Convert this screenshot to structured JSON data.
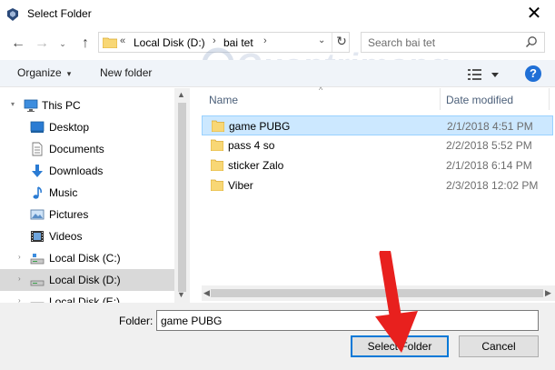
{
  "window": {
    "title": "Select Folder",
    "close_glyph": "✕"
  },
  "nav": {
    "back_glyph": "←",
    "forward_glyph": "→",
    "recent_glyph": "⌄",
    "up_glyph": "↑"
  },
  "address": {
    "overflow": "«",
    "segments": [
      "Local Disk (D:)",
      "bai tet"
    ],
    "separator": "›",
    "chevron": "⌄",
    "refresh_glyph": "↻"
  },
  "search": {
    "placeholder": "Search bai tet"
  },
  "toolbar": {
    "organize_label": "Organize",
    "new_folder_label": "New folder",
    "caret": "▾",
    "help_label": "?"
  },
  "watermark": "Quantrimang",
  "sidebar": {
    "items": [
      {
        "label": "This PC",
        "icon": "pc-icon",
        "selected": false
      },
      {
        "label": "Desktop",
        "icon": "desktop-icon",
        "selected": false
      },
      {
        "label": "Documents",
        "icon": "documents-icon",
        "selected": false
      },
      {
        "label": "Downloads",
        "icon": "downloads-icon",
        "selected": false
      },
      {
        "label": "Music",
        "icon": "music-icon",
        "selected": false
      },
      {
        "label": "Pictures",
        "icon": "pictures-icon",
        "selected": false
      },
      {
        "label": "Videos",
        "icon": "videos-icon",
        "selected": false
      },
      {
        "label": "Local Disk (C:)",
        "icon": "drive-icon",
        "selected": false
      },
      {
        "label": "Local Disk (D:)",
        "icon": "drive-icon",
        "selected": true
      },
      {
        "label": "Local Disk (E:)",
        "icon": "drive-icon",
        "selected": false
      }
    ],
    "expand_glyph": "›"
  },
  "columns": {
    "name": "Name",
    "date_modified": "Date modified",
    "sort_glyph": "^"
  },
  "files": [
    {
      "name": "game PUBG",
      "date": "2/1/2018 4:51 PM",
      "selected": true
    },
    {
      "name": "pass 4 so",
      "date": "2/2/2018 5:52 PM",
      "selected": false
    },
    {
      "name": "sticker Zalo",
      "date": "2/1/2018 6:14 PM",
      "selected": false
    },
    {
      "name": "Viber",
      "date": "2/3/2018 12:02 PM",
      "selected": false
    }
  ],
  "scroll": {
    "up": "▲",
    "down": "▼",
    "left": "◀",
    "right": "▶"
  },
  "footer": {
    "folder_label": "Folder:",
    "folder_value": "game PUBG",
    "select_label": "Select Folder",
    "cancel_label": "Cancel"
  },
  "colors": {
    "accent": "#0078d7",
    "selection": "#cce8ff",
    "folder": "#f8d775",
    "annotation": "#e8201e"
  }
}
